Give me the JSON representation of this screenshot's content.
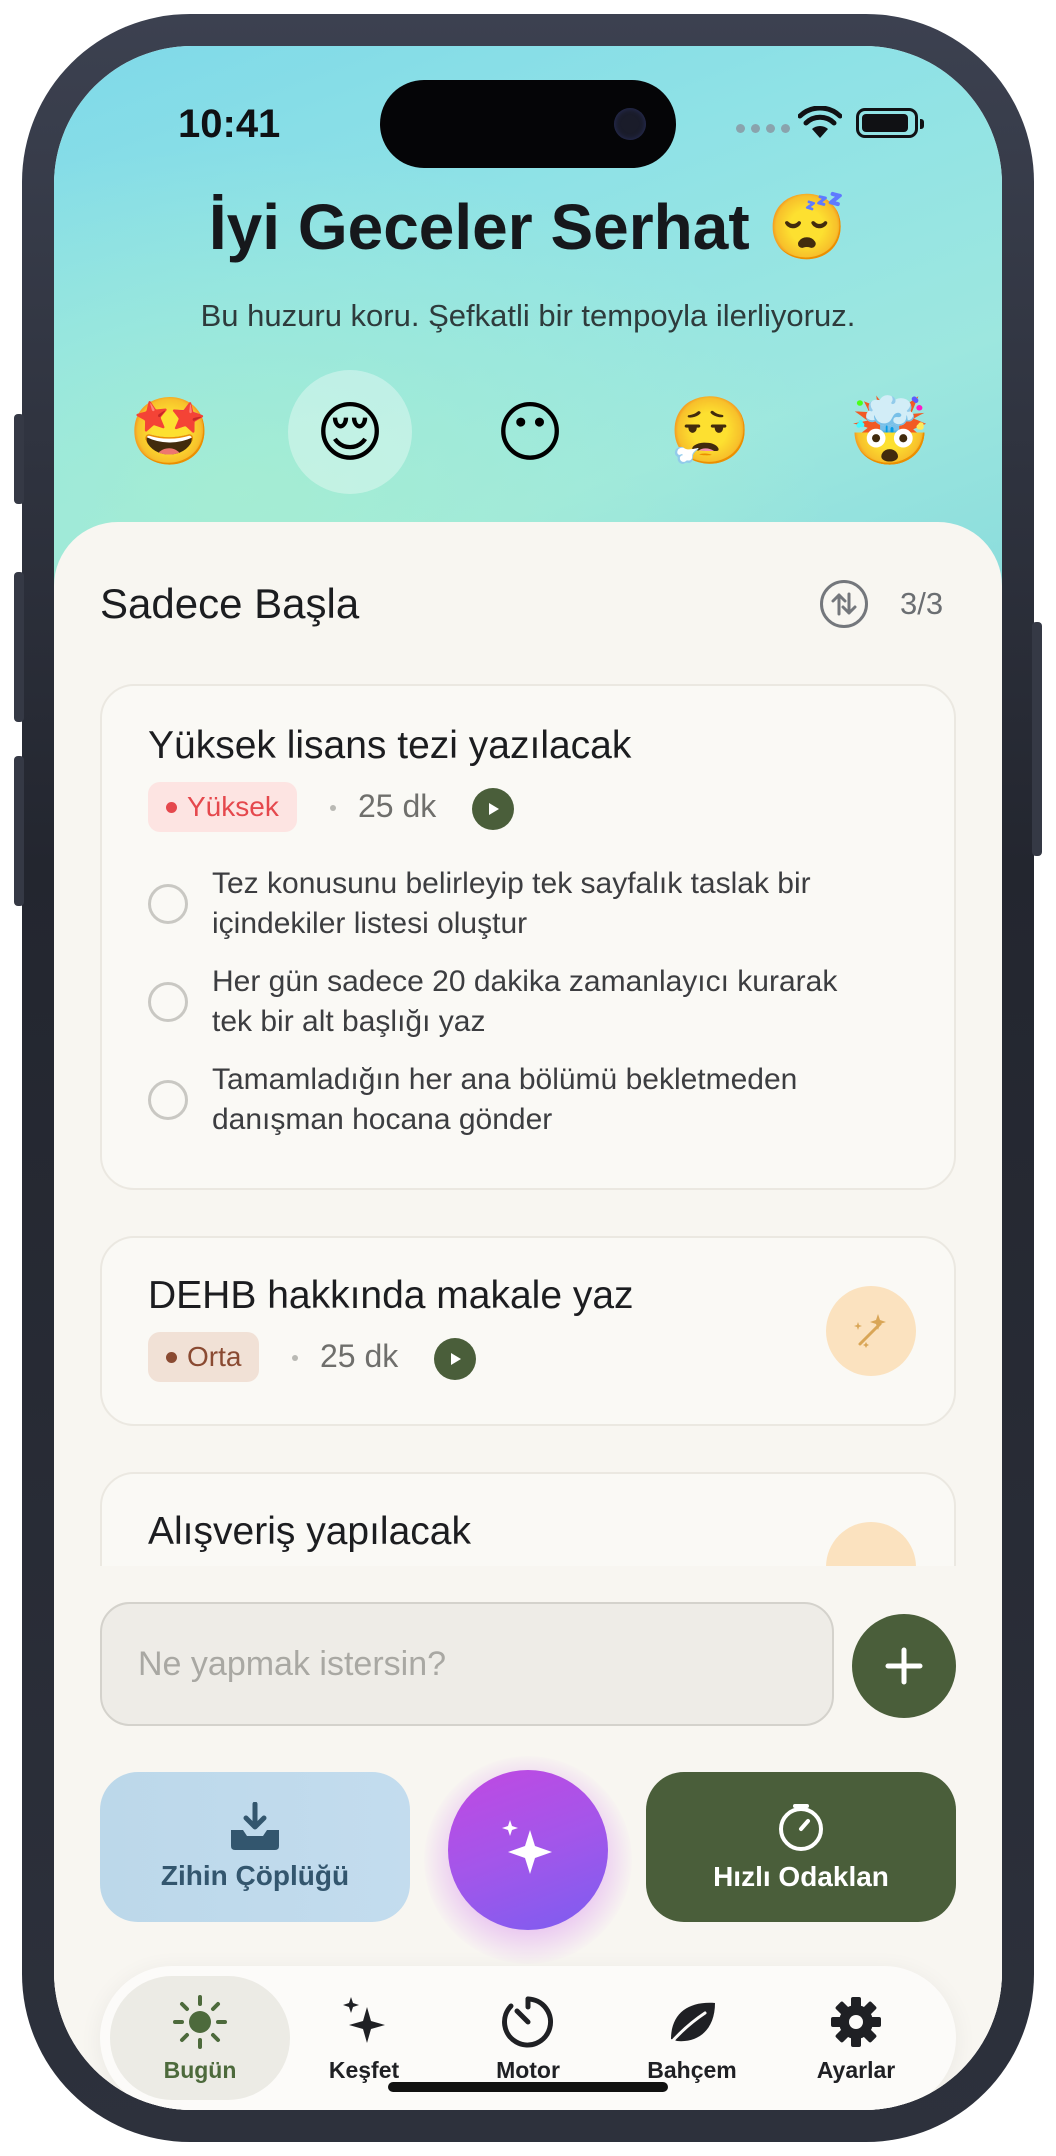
{
  "status": {
    "time": "10:41"
  },
  "header": {
    "greeting": "İyi Geceler Serhat 😴",
    "subtitle": "Bu huzuru koru. Şefkatli bir tempoyla ilerliyoruz."
  },
  "moods": [
    {
      "emoji": "🤩",
      "selected": false
    },
    {
      "emoji": "😌",
      "selected": true
    },
    {
      "emoji": "😶",
      "selected": false
    },
    {
      "emoji": "😮‍💨",
      "selected": false
    },
    {
      "emoji": "🤯",
      "selected": false
    }
  ],
  "section": {
    "title": "Sadece Başla",
    "count": "3/3",
    "sort_icon": "sort-arrows-icon"
  },
  "tasks": [
    {
      "title": "Yüksek lisans tezi yazılacak",
      "priority": "Yüksek",
      "priority_color": "#e5484d",
      "priority_bg": "#fde4e2",
      "duration": "25 dk",
      "subtasks": [
        {
          "line1": "Tez konusunu belirleyip tek sayfalık taslak bir",
          "line2": "içindekiler listesi oluştur"
        },
        {
          "line1": "Her gün sadece 20 dakika zamanlayıcı kurarak",
          "line2": "tek bir alt başlığı yaz"
        },
        {
          "line1": "Tamamladığın her ana bölümü bekletmeden",
          "line2": "danışman hocana gönder"
        }
      ]
    },
    {
      "title": "DEHB hakkında makale yaz",
      "priority": "Orta",
      "priority_color": "#8a4a32",
      "priority_bg": "#f1e1d6",
      "duration": "25 dk"
    },
    {
      "title": "Alışveriş yapılacak"
    }
  ],
  "composer": {
    "placeholder": "Ne yapmak istersin?"
  },
  "actions": {
    "dump": "Zihin Çöplüğü",
    "focus": "Hızlı Odaklan"
  },
  "tabs": [
    {
      "label": "Bugün",
      "icon": "sun-icon",
      "active": true
    },
    {
      "label": "Keşfet",
      "icon": "sparkles-icon",
      "active": false
    },
    {
      "label": "Motor",
      "icon": "timer-icon",
      "active": false
    },
    {
      "label": "Bahçem",
      "icon": "leaf-icon",
      "active": false
    },
    {
      "label": "Ayarlar",
      "icon": "gear-icon",
      "active": false
    }
  ],
  "colors": {
    "accent": "#4a5e3a",
    "magic": "#a356ea",
    "dump": "#bcd8ea"
  }
}
